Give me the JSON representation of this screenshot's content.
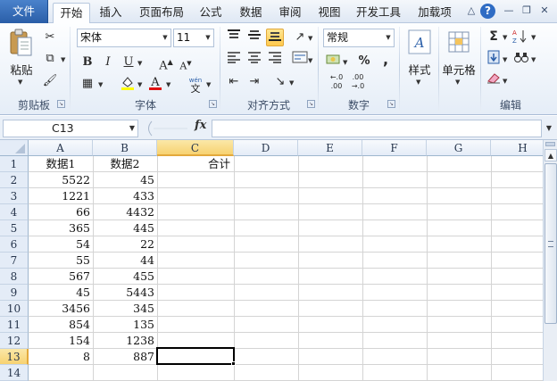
{
  "tabs": [
    {
      "label": "文件"
    },
    {
      "label": "开始"
    },
    {
      "label": "插入"
    },
    {
      "label": "页面布局"
    },
    {
      "label": "公式"
    },
    {
      "label": "数据"
    },
    {
      "label": "审阅"
    },
    {
      "label": "视图"
    },
    {
      "label": "开发工具"
    },
    {
      "label": "加载项"
    }
  ],
  "ribbon": {
    "clipboard": {
      "paste_label": "粘贴",
      "group_label": "剪贴板"
    },
    "font": {
      "font_name": "宋体",
      "font_size": "11",
      "group_label": "字体"
    },
    "alignment": {
      "group_label": "对齐方式"
    },
    "number": {
      "format": "常规",
      "group_label": "数字",
      "percent": "%",
      "comma": ","
    },
    "styles": {
      "label": "样式"
    },
    "cells": {
      "label": "单元格"
    },
    "editing": {
      "group_label": "编辑"
    }
  },
  "formula_bar": {
    "name_box": "C13",
    "fx": "fx",
    "formula": ""
  },
  "grid": {
    "columns": [
      "A",
      "B",
      "C",
      "D",
      "E",
      "F",
      "G",
      "H"
    ],
    "rows": [
      "1",
      "2",
      "3",
      "4",
      "5",
      "6",
      "7",
      "8",
      "9",
      "10",
      "11",
      "12",
      "13",
      "14"
    ],
    "selected_row": "13",
    "selected_col": "C",
    "headers": {
      "a1": "数据1",
      "b1": "数据2",
      "c1": "合计"
    },
    "data1": [
      "5522",
      "1221",
      "66",
      "365",
      "54",
      "55",
      "567",
      "45",
      "3456",
      "854",
      "154",
      "8"
    ],
    "data2": [
      "45",
      "433",
      "4432",
      "445",
      "22",
      "44",
      "455",
      "5443",
      "345",
      "135",
      "1238",
      "887"
    ]
  }
}
